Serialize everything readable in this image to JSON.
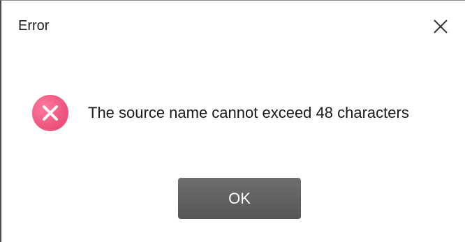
{
  "dialog": {
    "title": "Error",
    "message": "The source name cannot exceed 48 characters",
    "icon": "error-x-circle-icon",
    "icon_color": "#f0587f",
    "ok_label": "OK",
    "close_icon": "close-icon",
    "button_color": "#5e5e5e"
  }
}
